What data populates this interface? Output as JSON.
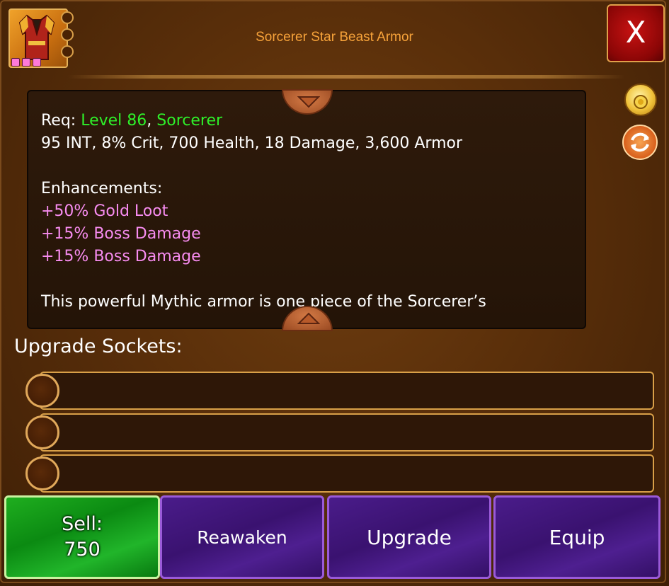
{
  "item": {
    "title": "Sorcerer Star Beast Armor",
    "icon": "armor-icon",
    "rarity_stars": 3,
    "side_socket_count": 3
  },
  "close_button": {
    "label": "X"
  },
  "description": {
    "req_prefix": "Req: ",
    "req_level": "Level 86",
    "req_sep": ", ",
    "req_class": "Sorcerer",
    "stats": "95 INT, 8% Crit, 700 Health, 18 Damage, 3,600 Armor",
    "enhancements_label": "Enhancements:",
    "enhancements": [
      "+50% Gold Loot",
      "+15% Boss Damage",
      "+15% Boss Damage"
    ],
    "flavor_text": "This powerful Mythic armor is one piece of the Sorcerer’s"
  },
  "side_icons": [
    "gold-bag-icon",
    "swap-icon"
  ],
  "sockets": {
    "label": "Upgrade Sockets:",
    "slots": [
      "",
      "",
      ""
    ]
  },
  "buttons": {
    "sell_label": "Sell:",
    "sell_value": "750",
    "reawaken": "Reawaken",
    "upgrade": "Upgrade",
    "equip": "Equip"
  },
  "colors": {
    "title": "#f7a33a",
    "requirement": "#2ef02a",
    "enhancement": "#f78cf0",
    "sell_button": "#0b8a12",
    "action_button": "#3a1270",
    "close_button": "#8b0606"
  }
}
